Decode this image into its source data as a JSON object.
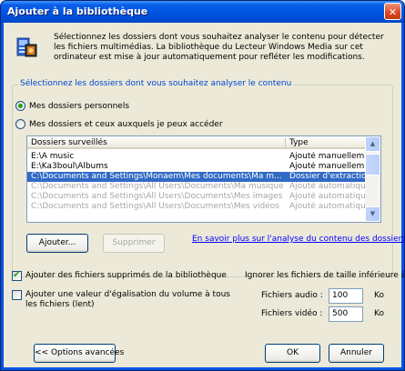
{
  "window": {
    "title": "Ajouter à la bibliothèque",
    "close_glyph": "✕"
  },
  "intro": {
    "text": "Sélectionnez les dossiers dont vous souhaitez analyser le contenu pour détecter les fichiers multimédias. La bibliothèque du Lecteur Windows Media sur cet ordinateur est mise à jour automatiquement pour refléter les modifications.",
    "icon": "media-library-icon"
  },
  "folders_group": {
    "title": "Sélectionnez les dossiers dont vous souhaitez analyser le contenu",
    "option1_label": "Mes dossiers personnels",
    "option2_label": "Mes dossiers et ceux auxquels je peux accéder",
    "selected_option": 1
  },
  "list": {
    "columns": [
      "Dossiers surveillés",
      "Type"
    ],
    "rows": [
      {
        "folder": "E:\\A music",
        "type": "Ajouté manuellement"
      },
      {
        "folder": "E:\\Ka3boul\\Albums",
        "type": "Ajouté manuellement"
      },
      {
        "folder": "C:\\Documents and Settings\\Monaem\\Mes documents\\Ma m...",
        "type": "Dossier d'extraction"
      },
      {
        "folder": "C:\\Documents and Settings\\All Users\\Documents\\Ma musique",
        "type": "Ajouté automatiqu..."
      },
      {
        "folder": "C:\\Documents and Settings\\All Users\\Documents\\Mes images",
        "type": "Ajouté automatiqu..."
      },
      {
        "folder": "C:\\Documents and Settings\\All Users\\Documents\\Mes vidéos",
        "type": "Ajouté automatiqu..."
      }
    ]
  },
  "buttons": {
    "add": "Ajouter...",
    "remove": "Supprimer",
    "advanced": "<< Options avancées",
    "ok": "OK",
    "cancel": "Annuler"
  },
  "link_text": "En savoir plus sur l'analyse du contenu des dossiers",
  "options": {
    "add_deleted_label": "Ajouter des fichiers supprimés de la bibliothèque",
    "add_deleted_checked": true,
    "volume_line1": "Ajouter une valeur d'égalisation du volume à tous",
    "volume_line2": "les fichiers (lent)",
    "volume_checked": false
  },
  "size_filter": {
    "title": "Ignorer les fichiers de taille inférieure à :",
    "audio_label": "Fichiers audio :",
    "audio_value": "100",
    "video_label": "Fichiers vidéo :",
    "video_value": "500",
    "unit": "Ko"
  },
  "colors": {
    "titlebar": "#0054e3",
    "selection": "#316ac5",
    "group_title": "#0046d5",
    "link": "#0000ff",
    "dialog_bg": "#ece9d8"
  }
}
